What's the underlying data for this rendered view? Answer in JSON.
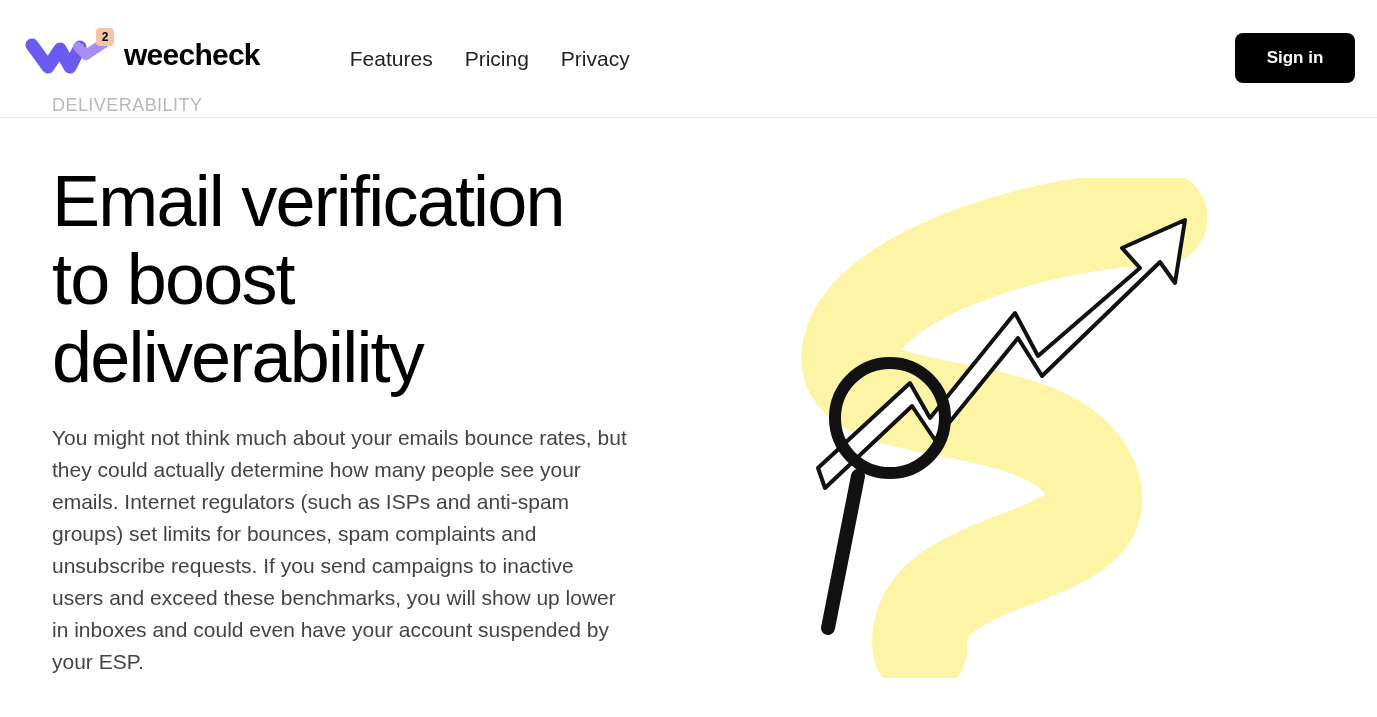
{
  "header": {
    "logo": {
      "badge": "2",
      "name": "weecheck"
    },
    "nav": [
      "Features",
      "Pricing",
      "Privacy"
    ],
    "sign_in": "Sign in"
  },
  "eyebrow": "DELIVERABILITY",
  "hero": {
    "title_lines": [
      "Email verification",
      "to boost",
      "deliverability"
    ],
    "body": "You might not think much about your emails bounce rates, but they could actually determine how many people see your emails. Internet regulators (such as ISPs and anti-spam groups) set limits for bounces, spam complaints and unsubscribe requests. If you send campaigns to inactive users and exceed these benchmarks, you will show up lower in inboxes and could even have your account suspended by your ESP."
  }
}
